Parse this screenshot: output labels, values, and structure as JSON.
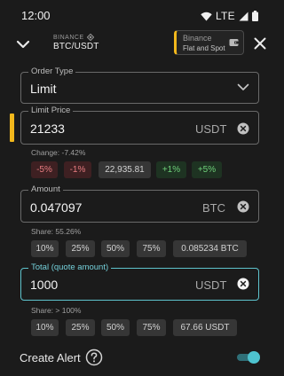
{
  "status_bar": {
    "time": "12:00",
    "network": "LTE"
  },
  "header": {
    "exchange": "BINANCE",
    "pair": "BTC/USDT",
    "account_name": "Binance",
    "account_type": "Flat and Spot",
    "icons": [
      "chevron-down-icon",
      "binance-logo-icon",
      "wallet-icon",
      "close-icon"
    ]
  },
  "order_type": {
    "label": "Order Type",
    "value": "Limit"
  },
  "limit_price": {
    "label": "Limit Price",
    "value": "21233",
    "unit": "USDT",
    "change_text": "Change: -7.42%",
    "chips": [
      "-5%",
      "-1%",
      "22,935.81",
      "+1%",
      "+5%"
    ]
  },
  "amount": {
    "label": "Amount",
    "value": "0.047097",
    "unit": "BTC",
    "share_text": "Share: 55.26%",
    "chips": [
      "10%",
      "25%",
      "50%",
      "75%",
      "0.085234 BTC"
    ]
  },
  "total": {
    "label": "Total (quote amount)",
    "value": "1000",
    "unit": "USDT",
    "share_text": "Share: > 100%",
    "chips": [
      "10%",
      "25%",
      "50%",
      "75%",
      "67.66 USDT"
    ]
  },
  "create_alert": {
    "label": "Create Alert",
    "enabled": true
  },
  "colors": {
    "accent": "#f2b81c",
    "teal": "#4ec3cf",
    "red": "#e77c80",
    "green": "#6fd17a"
  }
}
